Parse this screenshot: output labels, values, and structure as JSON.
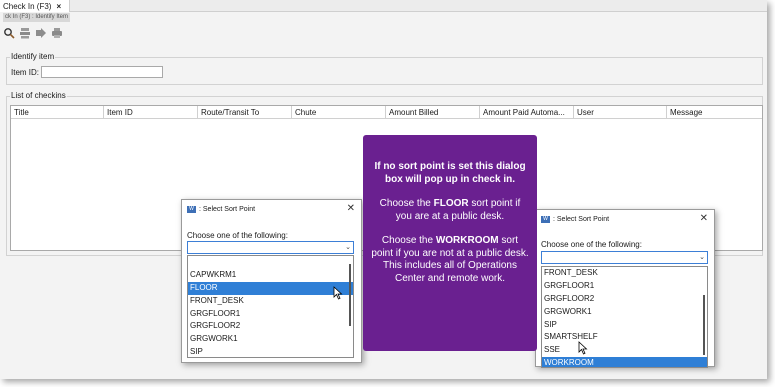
{
  "tab": {
    "label": "Check In (F3)",
    "close": "×"
  },
  "subtitle": "ck In (F3) : Identify Item",
  "toolbar": {
    "icons": [
      "check-in-icon",
      "stack-icon",
      "forward-icon",
      "printer-icon"
    ]
  },
  "identify": {
    "group_label": "Identify item",
    "item_id_label": "Item ID:",
    "item_id_value": ""
  },
  "checkins": {
    "group_label": "List of checkins",
    "columns": [
      "Title",
      "Item ID",
      "Route/Transit To",
      "Chute",
      "Amount Billed",
      "Amount Paid Automa...",
      "User",
      "Message"
    ]
  },
  "dialog_left": {
    "title": ": Select Sort Point",
    "app_icon": "W",
    "close": "✕",
    "prompt": "Choose one of the following:",
    "combo_value": "",
    "items": [
      "",
      "CAPWKRM1",
      "FLOOR",
      "FRONT_DESK",
      "GRGFLOOR1",
      "GRGFLOOR2",
      "GRGWORK1",
      "SIP"
    ],
    "selected": "FLOOR"
  },
  "dialog_right": {
    "title": ": Select Sort Point",
    "app_icon": "W",
    "close": "✕",
    "prompt": "Choose one of the following:",
    "combo_value": "",
    "items": [
      "FRONT_DESK",
      "GRGFLOOR1",
      "GRGFLOOR2",
      "GRGWORK1",
      "SIP",
      "SMARTSHELF",
      "SSE",
      "WORKROOM"
    ],
    "selected": "WORKROOM"
  },
  "callout": {
    "line1": "If no sort point is set this dialog box will pop up in check in.",
    "line2_pre": "Choose the ",
    "line2_bold": "FLOOR",
    "line2_post": " sort point if you are at a public desk.",
    "line3_pre": "Choose the ",
    "line3_bold": "WORKROOM",
    "line3_post": " sort point if you are not at a public desk. This includes all of Operations Center and remote work."
  },
  "colors": {
    "callout_bg": "#6a2090",
    "selection": "#2f7fd6",
    "combo_border": "#3d7fd6"
  }
}
